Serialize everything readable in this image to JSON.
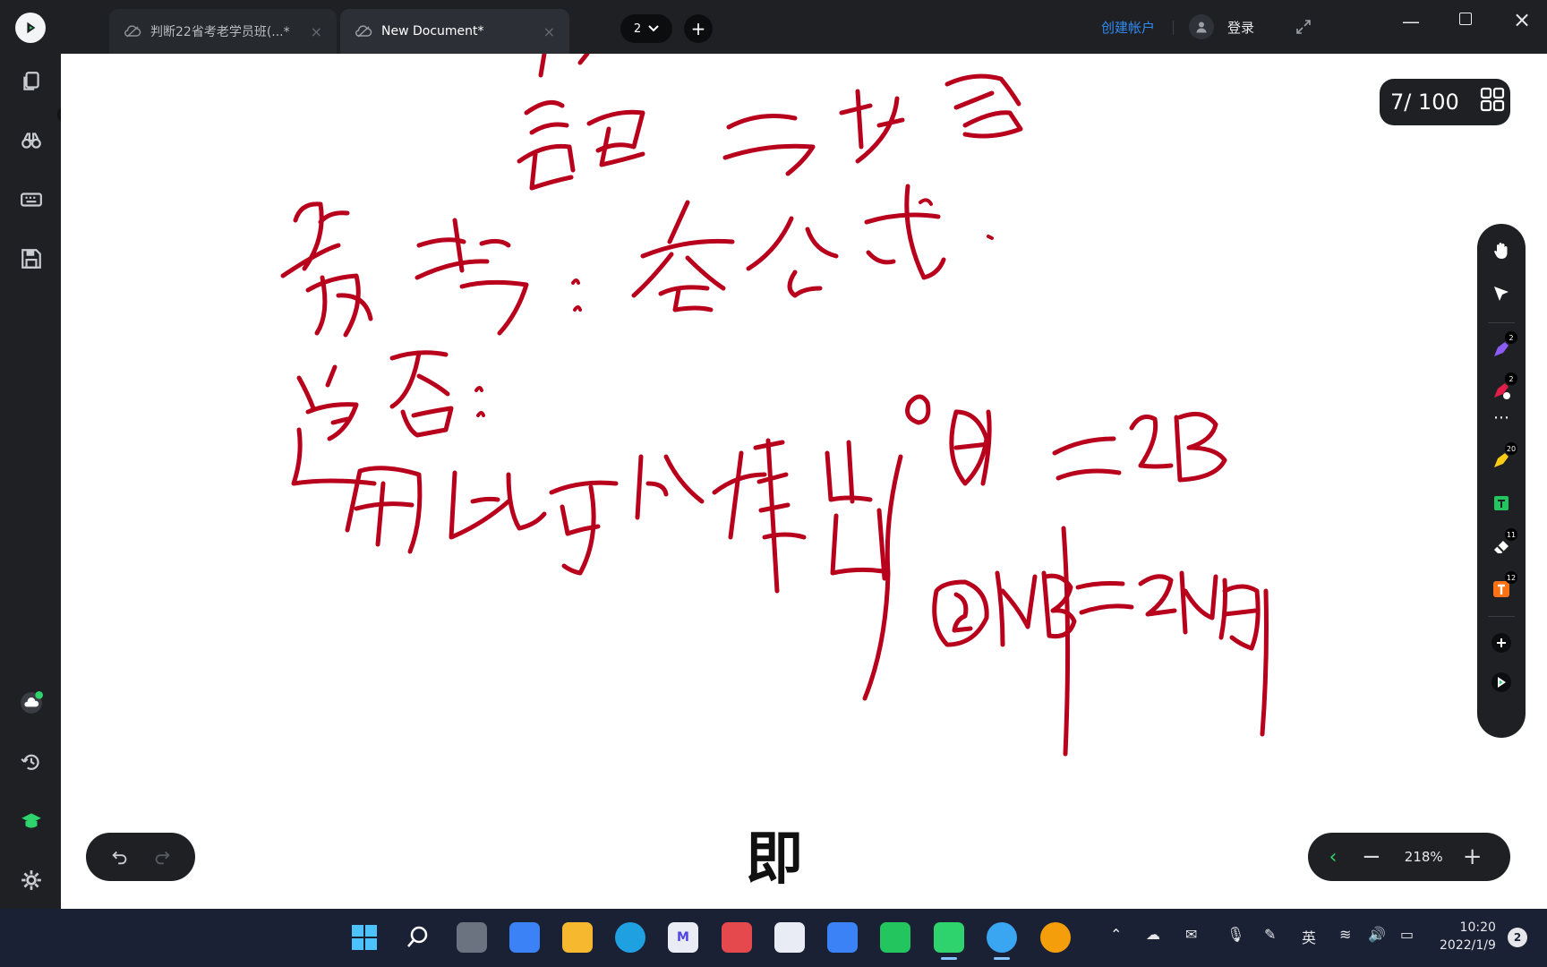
{
  "titlebar": {
    "tabs": [
      {
        "label": "判断22省考老学员班(...*"
      },
      {
        "label": "New Document*"
      }
    ],
    "page_select": "2",
    "add_page": "+",
    "create_account": "创建帐户",
    "login": "登录"
  },
  "page_counter": {
    "text": "7/ 100"
  },
  "toolbar": {
    "badges": {
      "pen1": "2",
      "pen2": "2",
      "highlighter": "20",
      "eraser": "11",
      "text": "12"
    },
    "more": "⋯"
  },
  "subtitle": "即",
  "zoom": {
    "value": "218%",
    "minus": "−",
    "plus": "+"
  },
  "taskbar": {
    "clock_time": "10:20",
    "clock_date": "2022/1/9",
    "notification_count": "2",
    "ime_label": "英"
  },
  "colors": {
    "ink": "#b8001c",
    "accent_blue": "#2f8bf0",
    "accent_green": "#2fd36d",
    "chrome": "#1e2024"
  }
}
